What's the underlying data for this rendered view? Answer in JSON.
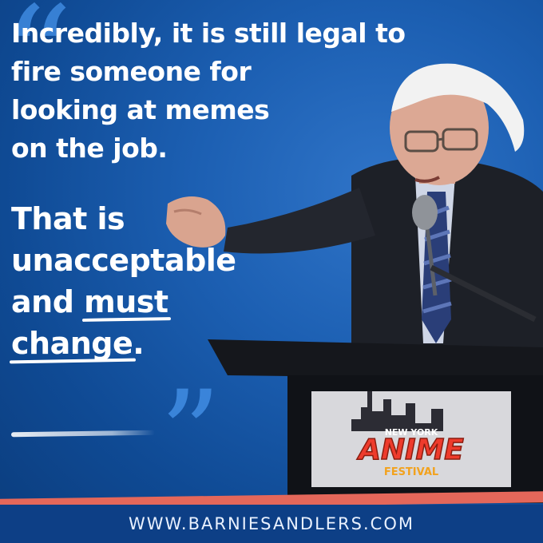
{
  "quote": {
    "lines": [
      "Incredibly, it is still legal to",
      "fire someone for",
      "looking at memes",
      "on the job."
    ],
    "emphasis": {
      "line1": "That is",
      "line2": "unacceptable",
      "line3_prefix": "and ",
      "line3_underlined": "must",
      "line4_underlined": "change",
      "line4_suffix": "."
    }
  },
  "podium_logo": {
    "top": "NEW YORK",
    "main": "ANIME",
    "bottom": "FESTIVAL"
  },
  "footer": {
    "url": "WWW.BARNIESANDLERS.COM"
  },
  "colors": {
    "background": "#1c5fb2",
    "quote_marks": "#3f8ae0",
    "stripe": "#e4675a",
    "footer_bar": "#0d3f86"
  }
}
